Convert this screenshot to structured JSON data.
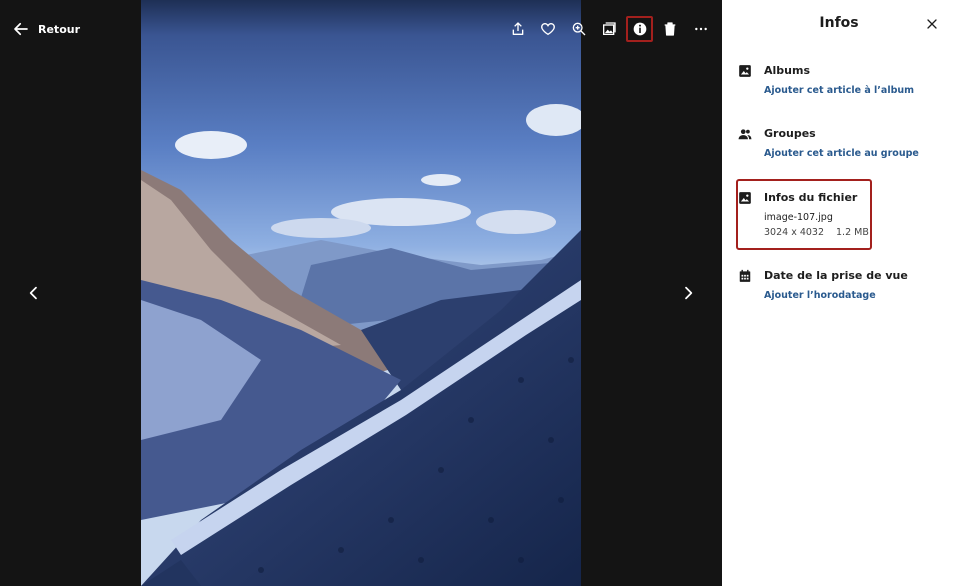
{
  "viewer": {
    "back_label": "Retour",
    "toolbar": [
      {
        "name": "share-icon",
        "label": ""
      },
      {
        "name": "heart-icon",
        "label": ""
      },
      {
        "name": "zoom-in-icon",
        "label": ""
      },
      {
        "name": "slideshow-icon",
        "label": ""
      },
      {
        "name": "info-icon",
        "label": "",
        "active": true
      },
      {
        "name": "trash-icon",
        "label": ""
      },
      {
        "name": "more-icon",
        "label": ""
      }
    ],
    "nav": {
      "prev": "chevron-left-icon",
      "next": "chevron-right-icon"
    }
  },
  "panel": {
    "title": "Infos",
    "albums": {
      "heading": "Albums",
      "link": "Ajouter cet article à l’album",
      "icon": "image-icon"
    },
    "groups": {
      "heading": "Groupes",
      "link": "Ajouter cet article au groupe",
      "icon": "people-icon"
    },
    "file_info": {
      "heading": "Infos du fichier",
      "filename": "image-107.jpg",
      "dimensions": "3024 x 4032",
      "size": "1.2 MB",
      "icon": "image-icon"
    },
    "date": {
      "heading": "Date de la prise de vue",
      "link": "Ajouter l’horodatage",
      "icon": "calendar-icon"
    }
  },
  "colors": {
    "viewer_bg": "#141414",
    "highlight": "#a3201d",
    "link": "#2a5a8e"
  }
}
